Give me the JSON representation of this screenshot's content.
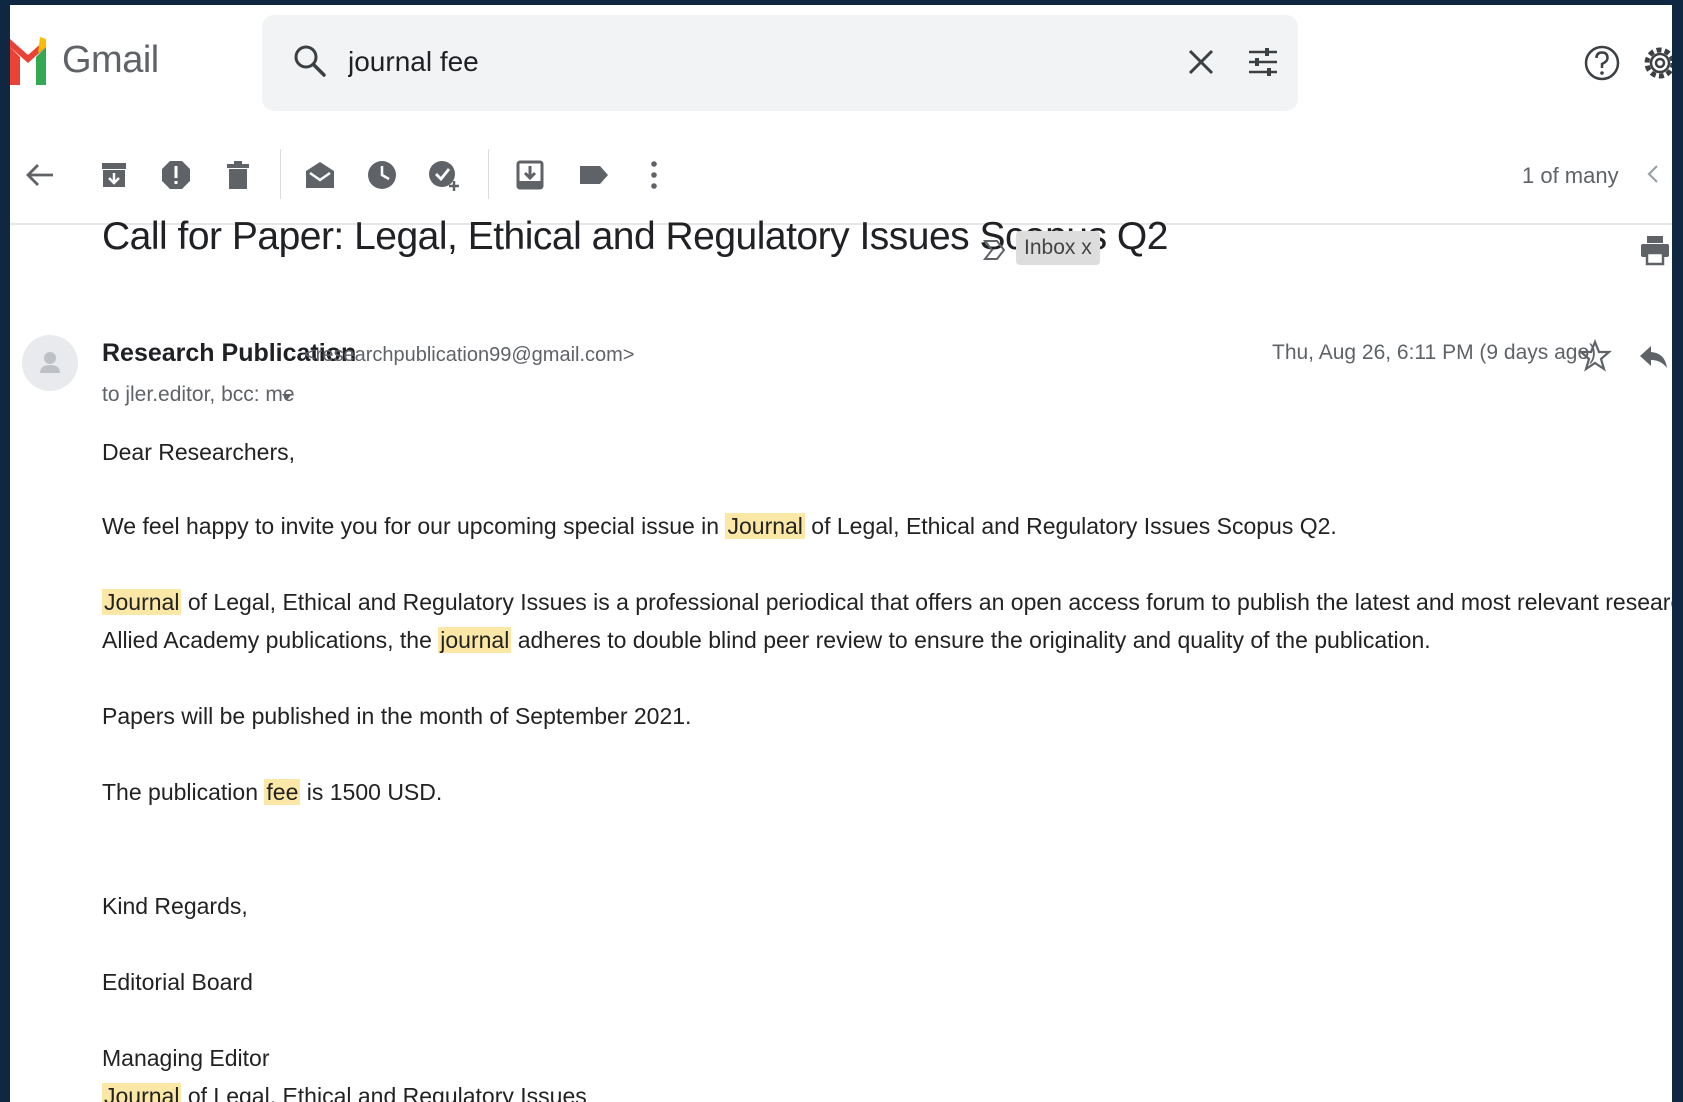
{
  "app": {
    "name": "Gmail"
  },
  "search": {
    "query": "journal fee"
  },
  "toolbar": {
    "pager": "1 of many"
  },
  "email": {
    "subject": "Call for Paper: Legal, Ethical and Regulatory Issues Scopus Q2",
    "label": "Inbox x",
    "sender_name": "Research Publication",
    "sender_email": "<researchpublication99@gmail.com>",
    "recipients": "to jler.editor, bcc: me",
    "date": "Thu, Aug 26, 6:11 PM (9 days ago)",
    "body": {
      "greeting": "Dear Researchers,",
      "p1_a": "We feel happy to invite you for our upcoming special issue in ",
      "p1_hl": "Journal",
      "p1_b": " of Legal, Ethical and Regulatory Issues Scopus Q2.",
      "p2_hl1": "Journal",
      "p2_a": " of Legal, Ethical and Regulatory Issues is a professional periodical that offers an open access forum to publish the latest and most relevant research innovations in this field. Affiliated to",
      "p2_b": "Allied Academy publications, the ",
      "p2_hl2": "journal",
      "p2_c": " adheres to double blind peer review to ensure the originality and quality of the publication.",
      "p3": "Papers will be published in the month of September 2021.",
      "p4_a": "The publication ",
      "p4_hl": "fee",
      "p4_b": " is 1500 USD.",
      "closing": "Kind Regards,",
      "sig1": "Editorial Board",
      "sig2": "Managing Editor",
      "sig3_hl": "Journal",
      "sig3_b": " of Legal, Ethical and Regulatory Issues"
    }
  },
  "colors": {
    "highlight": "#fce8a6",
    "frame": "#0f2740",
    "logo_red": "#ea4335",
    "logo_yellow": "#fbbc04",
    "logo_green": "#34a853"
  },
  "icons": [
    "search-icon",
    "clear-search-icon",
    "search-options-icon",
    "help-icon",
    "settings-icon",
    "back-arrow-icon",
    "archive-icon",
    "report-spam-icon",
    "delete-icon",
    "mark-unread-icon",
    "snooze-icon",
    "add-to-tasks-icon",
    "move-to-icon",
    "label-icon",
    "more-options-icon",
    "newer-chevron-icon",
    "importance-marker-icon",
    "print-icon",
    "avatar-icon",
    "star-icon",
    "reply-icon"
  ]
}
